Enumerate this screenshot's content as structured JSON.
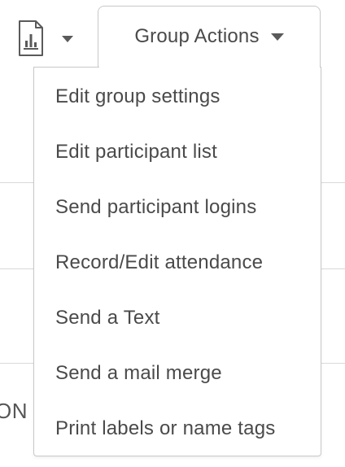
{
  "toolbar": {
    "report_icon": "report-document-icon",
    "report_caret_icon": "caret-down-icon",
    "group_actions_label": "Group Actions",
    "group_actions_caret_icon": "caret-down-icon"
  },
  "menu": {
    "items": [
      {
        "label": "Edit group settings"
      },
      {
        "label": "Edit participant list"
      },
      {
        "label": "Send participant logins"
      },
      {
        "label": "Record/Edit attendance"
      },
      {
        "label": "Send a Text"
      },
      {
        "label": "Send a mail merge"
      },
      {
        "label": "Print labels or name tags"
      }
    ]
  },
  "background": {
    "partial_text": "ON"
  },
  "colors": {
    "text": "#4a4a4a",
    "border": "#c8c8c8",
    "divider": "#d9d9d9",
    "icon": "#5a5a5a"
  }
}
